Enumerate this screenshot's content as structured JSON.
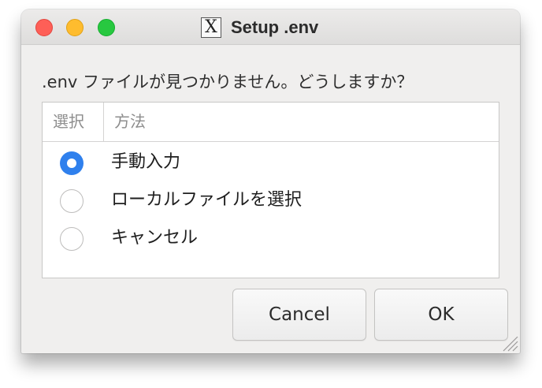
{
  "window": {
    "title": "Setup .env",
    "app_icon_glyph": "X"
  },
  "prompt": ".env ファイルが見つかりません。どうしますか？",
  "table": {
    "columns": [
      "選択",
      "方法"
    ],
    "rows": [
      {
        "label": "手動入力",
        "selected": true
      },
      {
        "label": "ローカルファイルを選択",
        "selected": false
      },
      {
        "label": "キャンセル",
        "selected": false
      }
    ]
  },
  "buttons": {
    "cancel_label": "Cancel",
    "ok_label": "OK"
  },
  "colors": {
    "accent": "#2f80ed",
    "close": "#fe5f57",
    "minimize": "#febc2e",
    "zoom": "#28c840"
  },
  "icons": {
    "app": "x11-icon",
    "resize": "resize-grip-icon"
  }
}
